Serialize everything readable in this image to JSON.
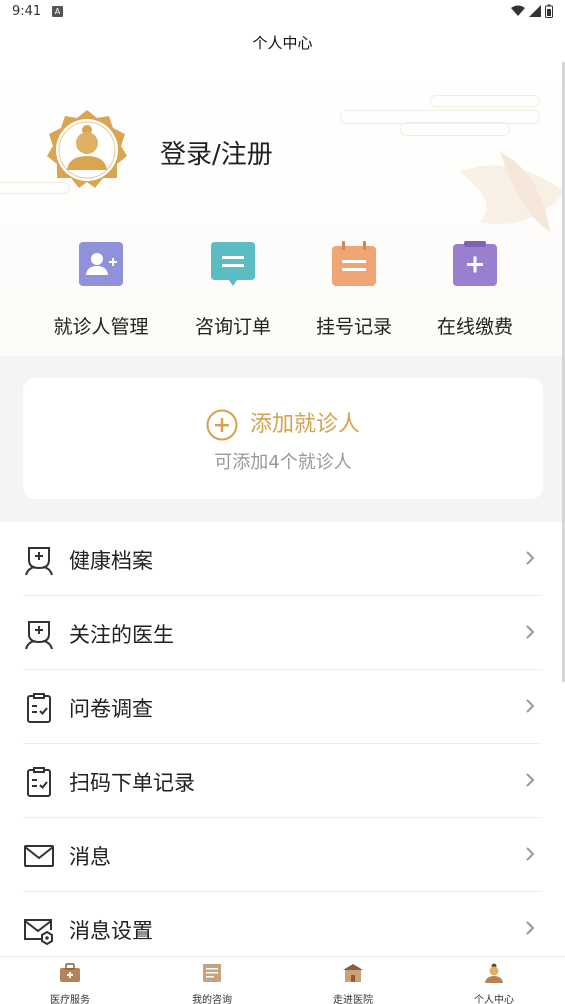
{
  "status_bar": {
    "time": "9:41",
    "notif_letter": "A"
  },
  "header": {
    "title": "个人中心"
  },
  "profile": {
    "login_label": "登录/注册"
  },
  "shortcuts": [
    {
      "label": "就诊人管理",
      "icon": "add-person-icon",
      "color": "#8f92d9"
    },
    {
      "label": "咨询订单",
      "icon": "chat-icon",
      "color": "#5bbcc4"
    },
    {
      "label": "挂号记录",
      "icon": "calendar-icon",
      "color": "#f0a674"
    },
    {
      "label": "在线缴费",
      "icon": "clipboard-plus-icon",
      "color": "#9a7fd0"
    }
  ],
  "add_patient": {
    "title": "添加就诊人",
    "subtitle": "可添加4个就诊人",
    "accent": "#d5a24e"
  },
  "menu": [
    {
      "label": "健康档案",
      "icon": "doctor-icon"
    },
    {
      "label": "关注的医生",
      "icon": "doctor-icon"
    },
    {
      "label": "问卷调查",
      "icon": "survey-icon"
    },
    {
      "label": "扫码下单记录",
      "icon": "survey-icon"
    },
    {
      "label": "消息",
      "icon": "mail-icon"
    },
    {
      "label": "消息设置",
      "icon": "mail-settings-icon"
    }
  ],
  "bottom_nav": [
    {
      "label": "医疗服务",
      "icon": "medical-kit-icon"
    },
    {
      "label": "我的咨询",
      "icon": "consult-icon"
    },
    {
      "label": "走进医院",
      "icon": "hospital-icon"
    },
    {
      "label": "个人中心",
      "icon": "profile-icon"
    }
  ]
}
